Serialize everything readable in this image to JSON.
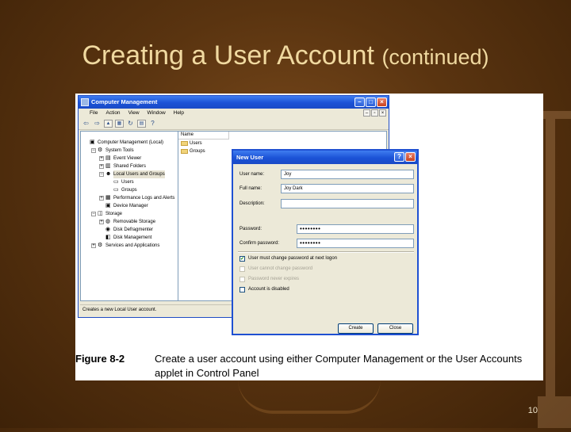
{
  "slide": {
    "title_main": "Creating a User Account",
    "title_cont": "(continued)",
    "page_number": "10"
  },
  "cm_window": {
    "title": "Computer Management",
    "menus": [
      "File",
      "Action",
      "View",
      "Window",
      "Help"
    ],
    "tree": [
      {
        "label": "Computer Management (Local)",
        "level": 0,
        "expander": "",
        "icon": "computer-icon",
        "glyph": "▣"
      },
      {
        "label": "System Tools",
        "level": 1,
        "expander": "−",
        "icon": "tools-icon",
        "glyph": "⚙"
      },
      {
        "label": "Event Viewer",
        "level": 2,
        "expander": "+",
        "icon": "event-viewer-icon",
        "glyph": "▤"
      },
      {
        "label": "Shared Folders",
        "level": 2,
        "expander": "+",
        "icon": "shared-folders-icon",
        "glyph": "▥"
      },
      {
        "label": "Local Users and Groups",
        "level": 2,
        "expander": "−",
        "icon": "users-groups-icon",
        "glyph": "☻"
      },
      {
        "label": "Users",
        "level": 3,
        "expander": "",
        "icon": "folder-icon",
        "glyph": "▭"
      },
      {
        "label": "Groups",
        "level": 3,
        "expander": "",
        "icon": "folder-icon",
        "glyph": "▭"
      },
      {
        "label": "Performance Logs and Alerts",
        "level": 2,
        "expander": "+",
        "icon": "performance-icon",
        "glyph": "▦"
      },
      {
        "label": "Device Manager",
        "level": 2,
        "expander": "",
        "icon": "device-manager-icon",
        "glyph": "▣"
      },
      {
        "label": "Storage",
        "level": 1,
        "expander": "−",
        "icon": "storage-icon",
        "glyph": "◫"
      },
      {
        "label": "Removable Storage",
        "level": 2,
        "expander": "+",
        "icon": "removable-storage-icon",
        "glyph": "◍"
      },
      {
        "label": "Disk Defragmenter",
        "level": 2,
        "expander": "",
        "icon": "defrag-icon",
        "glyph": "◉"
      },
      {
        "label": "Disk Management",
        "level": 2,
        "expander": "",
        "icon": "disk-management-icon",
        "glyph": "◧"
      },
      {
        "label": "Services and Applications",
        "level": 1,
        "expander": "+",
        "icon": "services-icon",
        "glyph": "⚙"
      }
    ],
    "list_header": "Name",
    "list_items": [
      "Users",
      "Groups"
    ],
    "status": "Creates a new Local User account."
  },
  "dialog": {
    "title": "New User",
    "fields": {
      "user_name_label": "User name:",
      "user_name_value": "Joy",
      "full_name_label": "Full name:",
      "full_name_value": "Joy Dark",
      "description_label": "Description:",
      "description_value": "",
      "password_label": "Password:",
      "password_value": "••••••••",
      "confirm_label": "Confirm password:",
      "confirm_value": "••••••••"
    },
    "checkboxes": [
      {
        "label": "User must change password at next logon",
        "checked": "✔",
        "enabled": true
      },
      {
        "label": "User cannot change password",
        "checked": "",
        "enabled": false
      },
      {
        "label": "Password never expires",
        "checked": "",
        "enabled": false
      },
      {
        "label": "Account is disabled",
        "checked": "",
        "enabled": true
      }
    ],
    "create_label": "Create",
    "close_label": "Close"
  },
  "caption": {
    "label": "Figure 8-2",
    "text": "Create a user account using either Computer Management or the User Accounts applet in Control Panel"
  }
}
